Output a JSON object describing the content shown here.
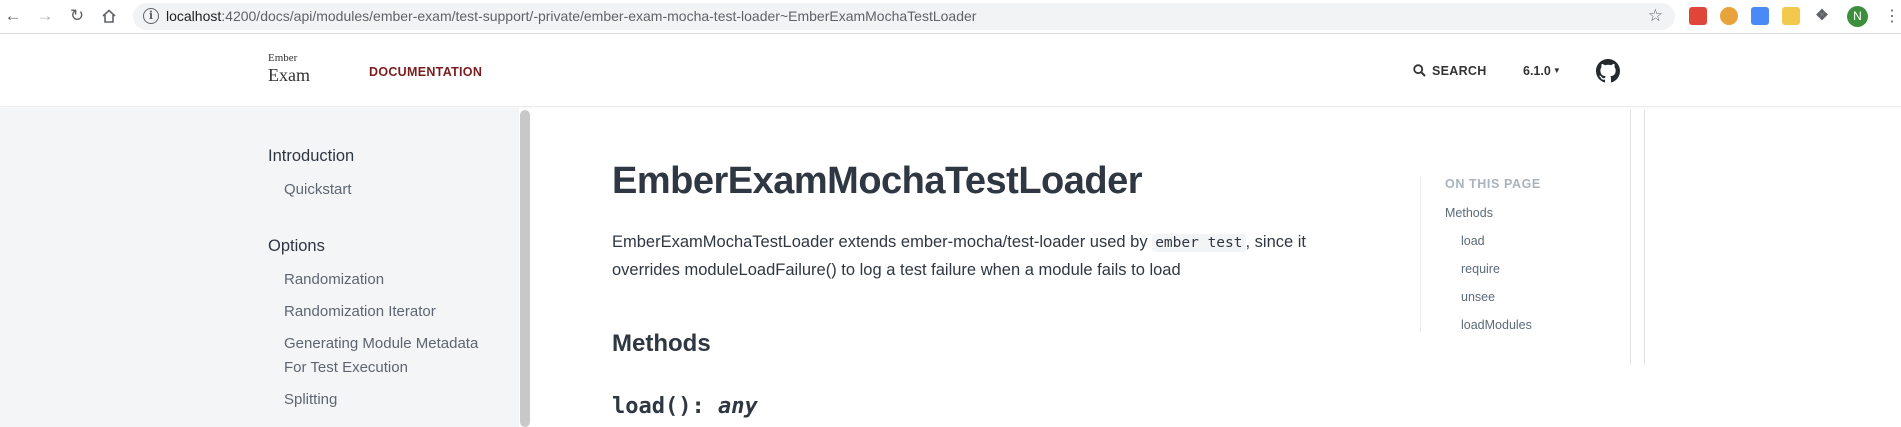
{
  "browser": {
    "url_host": "localhost",
    "url_rest": ":4200/docs/api/modules/ember-exam/test-support/-private/ember-exam-mocha-test-loader~EmberExamMochaTestLoader",
    "avatar_letter": "N",
    "extensions": [
      {
        "icon": "red-extension-icon",
        "color": "#e0453a"
      },
      {
        "icon": "orange-extension-icon",
        "color": "#e8a33c"
      },
      {
        "icon": "blue-extension-icon",
        "color": "#4a8af4"
      },
      {
        "icon": "yellow-extension-icon",
        "color": "#f2c94c"
      },
      {
        "icon": "green-extension-icon",
        "color": "#2fa84f"
      }
    ]
  },
  "header": {
    "logo_line1": "Ember",
    "logo_line2": "Exam",
    "nav_documentation": "DOCUMENTATION",
    "search_label": "SEARCH",
    "version": "6.1.0"
  },
  "sidebar": {
    "sections": [
      {
        "title": "Introduction",
        "items": [
          "Quickstart"
        ]
      },
      {
        "title": "Options",
        "items": [
          "Randomization",
          "Randomization Iterator",
          "Generating Module Metadata For Test Execution",
          "Splitting"
        ]
      }
    ]
  },
  "main": {
    "title": "EmberExamMochaTestLoader",
    "desc_part1": "EmberExamMochaTestLoader extends ember-mocha/test-loader used by ",
    "desc_code": "ember test",
    "desc_part2": ", since it overrides moduleLoadFailure() to log a test failure when a module fails to load",
    "methods_heading": "Methods",
    "sig_name": "load(): ",
    "sig_type": "any"
  },
  "on_this_page": {
    "title": "ON THIS PAGE",
    "section": "Methods",
    "links": [
      "load",
      "require",
      "unsee",
      "loadModules"
    ]
  },
  "colors": {
    "accent": "#7b1d1d",
    "sidebar_bg": "#f4f5f7",
    "text": "#2f3742"
  }
}
